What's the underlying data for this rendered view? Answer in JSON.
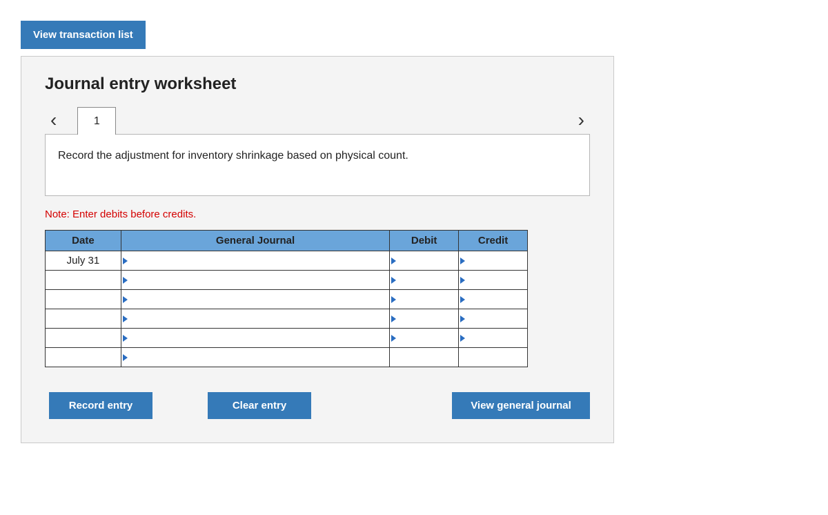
{
  "top_button": "View transaction list",
  "panel_title": "Journal entry worksheet",
  "tab_label": "1",
  "instruction": "Record the adjustment for inventory shrinkage based on physical count.",
  "note": "Note: Enter debits before credits.",
  "headers": {
    "date": "Date",
    "gj": "General Journal",
    "debit": "Debit",
    "credit": "Credit"
  },
  "rows": [
    {
      "date": "July 31",
      "gj": "",
      "debit": "",
      "credit": ""
    },
    {
      "date": "",
      "gj": "",
      "debit": "",
      "credit": ""
    },
    {
      "date": "",
      "gj": "",
      "debit": "",
      "credit": ""
    },
    {
      "date": "",
      "gj": "",
      "debit": "",
      "credit": ""
    },
    {
      "date": "",
      "gj": "",
      "debit": "",
      "credit": ""
    },
    {
      "date": "",
      "gj": "",
      "debit": "",
      "credit": ""
    }
  ],
  "buttons": {
    "record": "Record entry",
    "clear": "Clear entry",
    "view": "View general journal"
  }
}
